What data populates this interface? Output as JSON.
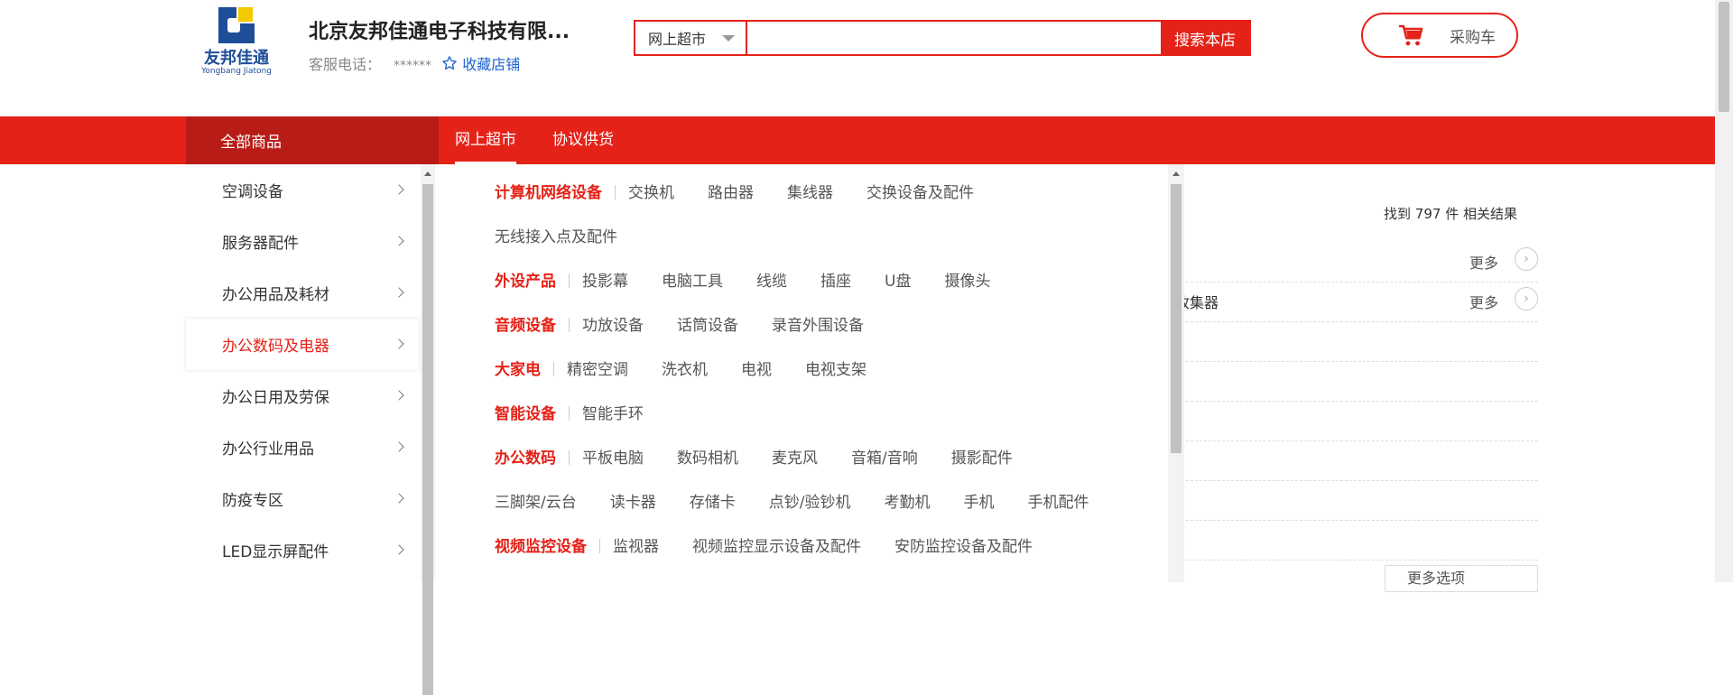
{
  "header": {
    "logo": {
      "cn": "友邦佳通",
      "en": "Yongbang Jiatong"
    },
    "shop_name": "北京友邦佳通电子科技有限...",
    "service_label": "客服电话：",
    "service_phone": "******",
    "favorite_label": "收藏店铺",
    "search": {
      "category": "网上超市",
      "placeholder": "",
      "button": "搜索本店"
    },
    "cart_label": "采购车"
  },
  "nav": {
    "all_goods": "全部商品",
    "tabs": [
      {
        "label": "网上超市"
      },
      {
        "label": "协议供货"
      }
    ]
  },
  "categories": [
    {
      "label": "空调设备"
    },
    {
      "label": "服务器配件"
    },
    {
      "label": "办公用品及耗材"
    },
    {
      "label": "办公数码及电器"
    },
    {
      "label": "办公日用及劳保"
    },
    {
      "label": "办公行业用品"
    },
    {
      "label": "防疫专区"
    },
    {
      "label": "LED显示屏配件"
    }
  ],
  "active_category": "办公数码及电器",
  "mega": {
    "groups": [
      {
        "head": "计算机网络设备",
        "items": [
          "交换机",
          "路由器",
          "集线器",
          "交换设备及配件"
        ]
      },
      {
        "head": "",
        "items": [
          "无线接入点及配件"
        ]
      },
      {
        "head": "外设产品",
        "items": [
          "投影幕",
          "电脑工具",
          "线缆",
          "插座",
          "U盘",
          "摄像头"
        ]
      },
      {
        "head": "音频设备",
        "items": [
          "功放设备",
          "话筒设备",
          "录音外围设备"
        ]
      },
      {
        "head": "大家电",
        "items": [
          "精密空调",
          "洗衣机",
          "电视",
          "电视支架"
        ]
      },
      {
        "head": "智能设备",
        "items": [
          "智能手环"
        ]
      },
      {
        "head": "办公数码",
        "items": [
          "平板电脑",
          "数码相机",
          "麦克风",
          "音箱/音响",
          "摄影配件"
        ]
      },
      {
        "head": "",
        "items": [
          "三脚架/云台",
          "读卡器",
          "存储卡",
          "点钞/验钞机",
          "考勤机",
          "手机",
          "手机配件"
        ]
      },
      {
        "head": "视频监控设备",
        "items": [
          "监视器",
          "视频监控显示设备及配件",
          "安防监控设备及配件"
        ]
      }
    ]
  },
  "results": {
    "prefix": "找到",
    "count": "797",
    "suffix": "件 相关结果",
    "more_label": "更多",
    "collector_text": "收集器",
    "more_options": "更多选项"
  },
  "colors": {
    "brand_red": "#e52218",
    "dark_red": "#b81c16",
    "logo_blue": "#1f4e99",
    "link_blue": "#1f62c9"
  }
}
